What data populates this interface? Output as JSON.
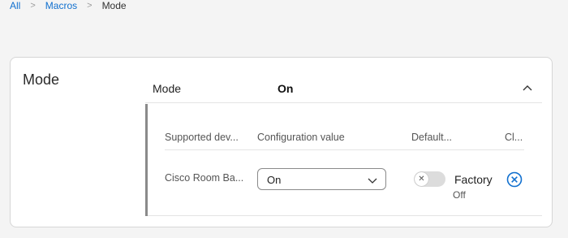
{
  "breadcrumb": {
    "items": [
      "All",
      "Macros"
    ],
    "current": "Mode",
    "separator": ">"
  },
  "card": {
    "title": "Mode",
    "section": {
      "label": "Mode",
      "value": "On",
      "expanded": true
    },
    "table": {
      "headers": [
        "Supported dev...",
        "Configuration value",
        "Default...",
        "Cl..."
      ],
      "rows": [
        {
          "device": "Cisco Room Ba...",
          "config_value": "On",
          "default_toggle": false,
          "default_label": "Factory",
          "default_sub": "Off"
        }
      ]
    }
  },
  "colors": {
    "accent": "#1170cf",
    "border": "#d6d6d6",
    "background": "#f4f4f4"
  }
}
